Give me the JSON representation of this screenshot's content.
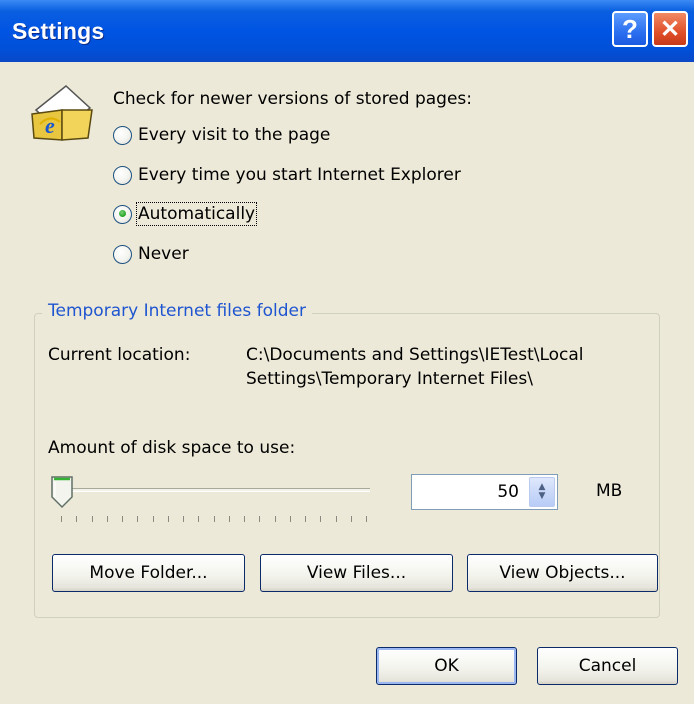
{
  "window": {
    "title": "Settings",
    "help_glyph": "?",
    "close_glyph": "✕"
  },
  "check_section": {
    "label": "Check for newer versions of stored pages:",
    "options": [
      {
        "label": "Every visit to the page",
        "checked": false
      },
      {
        "label": "Every time you start Internet Explorer",
        "checked": false
      },
      {
        "label": "Automatically",
        "checked": true
      },
      {
        "label": "Never",
        "checked": false
      }
    ]
  },
  "temp_folder": {
    "group_title": "Temporary Internet files folder",
    "current_location_label": "Current location:",
    "location_line1": "C:\\Documents and Settings\\IETest\\Local",
    "location_line2": "Settings\\Temporary Internet Files\\",
    "disk_label": "Amount of disk space to use:",
    "disk_value": "50",
    "disk_unit": "MB",
    "slider_level_fraction": 0.02
  },
  "buttons": {
    "move_folder": "Move Folder...",
    "view_files": "View Files...",
    "view_objects": "View Objects...",
    "ok": "OK",
    "cancel": "Cancel"
  },
  "icons": {
    "app": "ie-document-icon",
    "help": "help-icon",
    "close": "close-icon",
    "spin_up": "spin-up-icon",
    "spin_down": "spin-down-icon"
  }
}
